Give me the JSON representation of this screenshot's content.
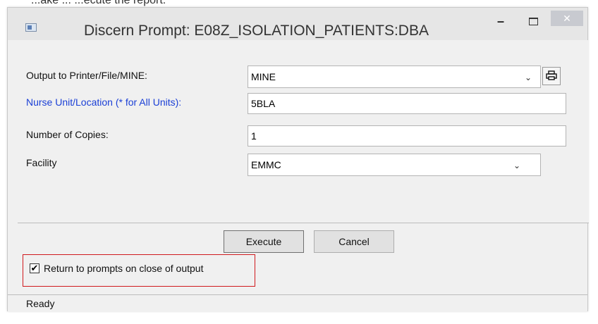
{
  "background_partial_text": "...ake ... ...ecute the report.",
  "window": {
    "title": "Discern Prompt: E08Z_ISOLATION_PATIENTS:DBA",
    "controls": {
      "minimize": "–",
      "close": "✕"
    }
  },
  "form": {
    "output_label": "Output to Printer/File/MINE:",
    "output_value": "MINE",
    "nurse_unit_label": "Nurse Unit/Location (* for All Units):",
    "nurse_unit_value": "5BLA",
    "copies_label": "Number of Copies:",
    "copies_value": "1",
    "facility_label": "Facility",
    "facility_value": "EMMC"
  },
  "buttons": {
    "execute": "Execute",
    "cancel": "Cancel"
  },
  "checkbox": {
    "label": "Return to prompts on close of output",
    "checked": true,
    "check_glyph": "✔"
  },
  "status": {
    "text": "Ready"
  },
  "icons": {
    "dropdown": "chevron-down-icon",
    "printer": "printer-icon",
    "app": "app-window-icon"
  },
  "colors": {
    "blue_label": "#1a3fd6",
    "highlight_border": "#d0191d"
  }
}
